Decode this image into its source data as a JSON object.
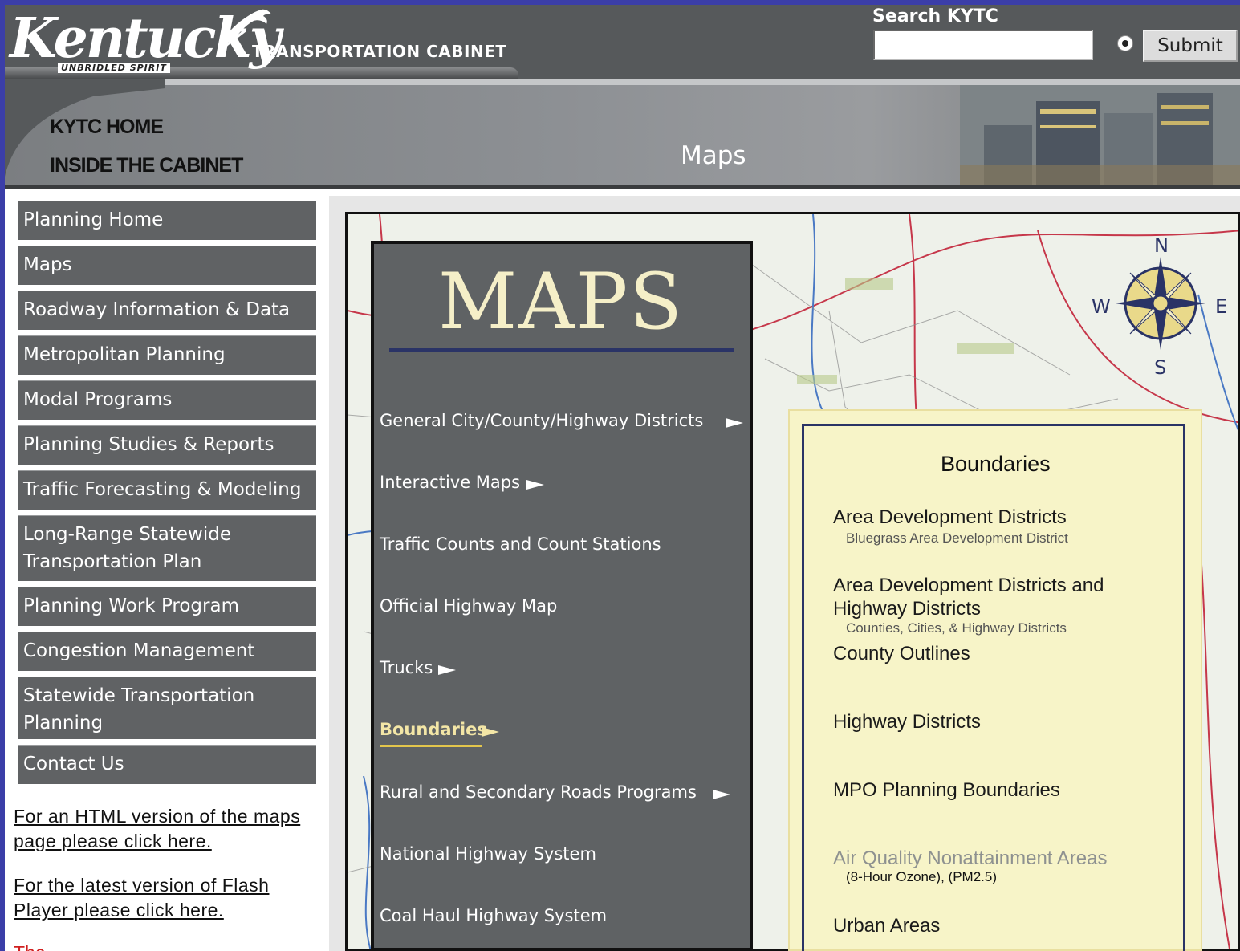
{
  "header": {
    "logo_word": "Kentucky",
    "logo_tagline": "UNBRIDLED SPIRIT",
    "agency": "TRANSPORTATION CABINET",
    "search_label": "Search KYTC",
    "search_value": "",
    "submit_label": "Submit"
  },
  "topnav": {
    "home": "KYTC HOME",
    "inside": "INSIDE THE CABINET",
    "page_heading": "Maps"
  },
  "sidebar": {
    "items": [
      {
        "label": "Planning Home"
      },
      {
        "label": "Maps"
      },
      {
        "label": "Roadway Information & Data"
      },
      {
        "label": "Metropolitan Planning"
      },
      {
        "label": "Modal Programs"
      },
      {
        "label": "Planning Studies & Reports"
      },
      {
        "label": "Traffic Forecasting & Modeling"
      },
      {
        "label": "Long-Range Statewide Transportation Plan"
      },
      {
        "label": "Planning Work Program"
      },
      {
        "label": "Congestion Management"
      },
      {
        "label": "Statewide  Transportation Planning"
      },
      {
        "label": "Contact Us"
      }
    ],
    "links": [
      {
        "label": "For an HTML version of the maps page please click here."
      },
      {
        "label": "For the latest version of Flash Player please click here."
      }
    ],
    "note": "The"
  },
  "flash": {
    "title": "MAPS",
    "items": [
      {
        "label": "General City/County/Highway Districts"
      },
      {
        "label": "Interactive Maps"
      },
      {
        "label": "Traffic Counts and Count Stations"
      },
      {
        "label": "Official Highway Map"
      },
      {
        "label": "Trucks"
      },
      {
        "label": "Boundaries"
      },
      {
        "label": "Rural and Secondary Roads Programs"
      },
      {
        "label": "National Highway System"
      },
      {
        "label": "Coal Haul Highway System"
      }
    ],
    "compass": {
      "n": "N",
      "s": "S",
      "e": "E",
      "w": "W"
    }
  },
  "boundaries": {
    "title": "Boundaries",
    "items": [
      {
        "label": "Area Development Districts",
        "desc": "Bluegrass Area Development District"
      },
      {
        "label": "Area Development Districts and Highway Districts",
        "desc": "Counties, Cities, & Highway Districts"
      },
      {
        "label": "County Outlines"
      },
      {
        "label": "Highway Districts"
      },
      {
        "label": "MPO Planning Boundaries"
      },
      {
        "label": "Air Quality Nonattainment Areas",
        "desc": "(8-Hour Ozone), (PM2.5)"
      },
      {
        "label": "Urban Areas"
      }
    ]
  },
  "colors": {
    "header_bg": "#56595b",
    "menu_bg": "#606264",
    "flash_panel_bg": "#5f6264",
    "maps_title": "#f5efc8",
    "active_item": "#f3e6a6",
    "submenu_bg": "#f7f4c8",
    "submenu_border": "#2a3366",
    "page_border": "#3b3ea8"
  }
}
